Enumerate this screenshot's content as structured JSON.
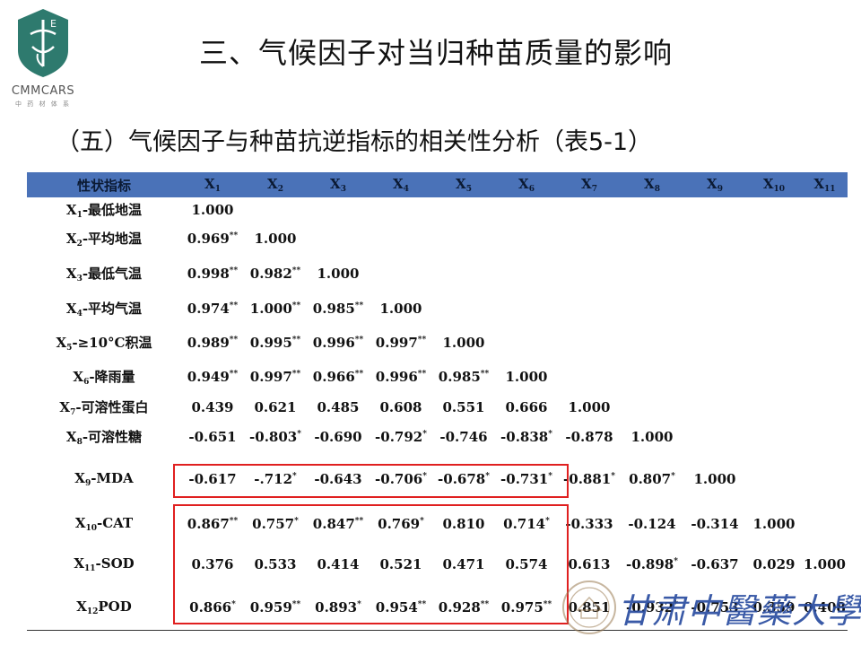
{
  "logo": {
    "name": "CMMCARS",
    "sub": "中 药 材 体 系",
    "mark": "E"
  },
  "page_title": "三、气候因子对当归种苗质量的影响",
  "subtitle": "（五）气候因子与种苗抗逆指标的相关性分析（表5-1）",
  "watermark": {
    "university": "甘肃中醫藥大學"
  },
  "colors": {
    "header_bg": "#4a72b8",
    "highlight": "#e02020",
    "univ_blue": "#2a4da0"
  },
  "table": {
    "header_label": "性状指标",
    "columns": [
      {
        "base": "X",
        "sub": "1"
      },
      {
        "base": "X",
        "sub": "2"
      },
      {
        "base": "X",
        "sub": "3"
      },
      {
        "base": "X",
        "sub": "4"
      },
      {
        "base": "X",
        "sub": "5"
      },
      {
        "base": "X",
        "sub": "6"
      },
      {
        "base": "X",
        "sub": "7"
      },
      {
        "base": "X",
        "sub": "8"
      },
      {
        "base": "X",
        "sub": "9"
      },
      {
        "base": "X",
        "sub": "10"
      },
      {
        "base": "X",
        "sub": "11"
      }
    ],
    "rows": [
      {
        "pre": "X",
        "sub": "1",
        "post": "-最低地温",
        "cells": [
          {
            "v": "1.000",
            "s": ""
          }
        ]
      },
      {
        "pre": "X",
        "sub": "2",
        "post": "-平均地温",
        "cells": [
          {
            "v": "0.969",
            "s": "**"
          },
          {
            "v": "1.000",
            "s": ""
          }
        ]
      },
      {
        "pre": "X",
        "sub": "3",
        "post": "-最低气温",
        "cells": [
          {
            "v": "0.998",
            "s": "**"
          },
          {
            "v": "0.982",
            "s": "**"
          },
          {
            "v": "1.000",
            "s": ""
          }
        ]
      },
      {
        "pre": "X",
        "sub": "4",
        "post": "-平均气温",
        "cells": [
          {
            "v": "0.974",
            "s": "**"
          },
          {
            "v": "1.000",
            "s": "**"
          },
          {
            "v": "0.985",
            "s": "**"
          },
          {
            "v": "1.000",
            "s": ""
          }
        ]
      },
      {
        "pre": "X",
        "sub": "5",
        "post": "-≥10°C积温",
        "cells": [
          {
            "v": "0.989",
            "s": "**"
          },
          {
            "v": "0.995",
            "s": "**"
          },
          {
            "v": "0.996",
            "s": "**"
          },
          {
            "v": "0.997",
            "s": "**"
          },
          {
            "v": "1.000",
            "s": ""
          }
        ]
      },
      {
        "pre": "X",
        "sub": "6",
        "post": "-降雨量",
        "cells": [
          {
            "v": "0.949",
            "s": "**"
          },
          {
            "v": "0.997",
            "s": "**"
          },
          {
            "v": "0.966",
            "s": "**"
          },
          {
            "v": "0.996",
            "s": "**"
          },
          {
            "v": "0.985",
            "s": "**"
          },
          {
            "v": "1.000",
            "s": ""
          }
        ]
      },
      {
        "pre": "X",
        "sub": "7",
        "post": "-可溶性蛋白",
        "cells": [
          {
            "v": "0.439",
            "s": ""
          },
          {
            "v": "0.621",
            "s": ""
          },
          {
            "v": "0.485",
            "s": ""
          },
          {
            "v": "0.608",
            "s": ""
          },
          {
            "v": "0.551",
            "s": ""
          },
          {
            "v": "0.666",
            "s": ""
          },
          {
            "v": "1.000",
            "s": ""
          }
        ]
      },
      {
        "pre": "X",
        "sub": "8",
        "post": "-可溶性糖",
        "cells": [
          {
            "v": "-0.651",
            "s": ""
          },
          {
            "v": "-0.803",
            "s": "*"
          },
          {
            "v": "-0.690",
            "s": ""
          },
          {
            "v": "-0.792",
            "s": "*"
          },
          {
            "v": "-0.746",
            "s": ""
          },
          {
            "v": "-0.838",
            "s": "*"
          },
          {
            "v": "-0.878",
            "s": ""
          },
          {
            "v": "1.000",
            "s": ""
          }
        ]
      },
      {
        "pre": "X",
        "sub": "9",
        "post": "-MDA",
        "cells": [
          {
            "v": "-0.617",
            "s": ""
          },
          {
            "v": "-.712",
            "s": "*"
          },
          {
            "v": "-0.643",
            "s": ""
          },
          {
            "v": "-0.706",
            "s": "*"
          },
          {
            "v": "-0.678",
            "s": "*"
          },
          {
            "v": "-0.731",
            "s": "*"
          },
          {
            "v": "-0.881",
            "s": "*"
          },
          {
            "v": "0.807",
            "s": "*"
          },
          {
            "v": "1.000",
            "s": ""
          }
        ]
      },
      {
        "pre": "X",
        "sub": "10",
        "post": "-CAT",
        "cells": [
          {
            "v": "0.867",
            "s": "**"
          },
          {
            "v": "0.757",
            "s": "*"
          },
          {
            "v": "0.847",
            "s": "**"
          },
          {
            "v": "0.769",
            "s": "*"
          },
          {
            "v": "0.810",
            "s": ""
          },
          {
            "v": "0.714",
            "s": "*"
          },
          {
            "v": "-0.333",
            "s": ""
          },
          {
            "v": "-0.124",
            "s": ""
          },
          {
            "v": "-0.314",
            "s": ""
          },
          {
            "v": "1.000",
            "s": ""
          }
        ]
      },
      {
        "pre": "X",
        "sub": "11",
        "post": "-SOD",
        "cells": [
          {
            "v": "0.376",
            "s": ""
          },
          {
            "v": "0.533",
            "s": ""
          },
          {
            "v": "0.414",
            "s": ""
          },
          {
            "v": "0.521",
            "s": ""
          },
          {
            "v": "0.471",
            "s": ""
          },
          {
            "v": "0.574",
            "s": ""
          },
          {
            "v": "0.613",
            "s": ""
          },
          {
            "v": "-0.898",
            "s": "*"
          },
          {
            "v": "-0.637",
            "s": ""
          },
          {
            "v": "0.029",
            "s": ""
          },
          {
            "v": "1.000",
            "s": ""
          }
        ]
      },
      {
        "pre": "X",
        "sub": "12",
        "post": "POD",
        "cells": [
          {
            "v": "0.866",
            "s": "*"
          },
          {
            "v": "0.959",
            "s": "**"
          },
          {
            "v": "0.893",
            "s": "*"
          },
          {
            "v": "0.954",
            "s": "**"
          },
          {
            "v": "0.928",
            "s": "**"
          },
          {
            "v": "0.975",
            "s": "**"
          },
          {
            "v": "0.851",
            "s": ""
          },
          {
            "v": "-0.932",
            "s": "*"
          },
          {
            "v": "-0.753",
            "s": ""
          },
          {
            "v": "0.359",
            "s": ""
          },
          {
            "v": "0.408",
            "s": ""
          }
        ]
      }
    ]
  }
}
